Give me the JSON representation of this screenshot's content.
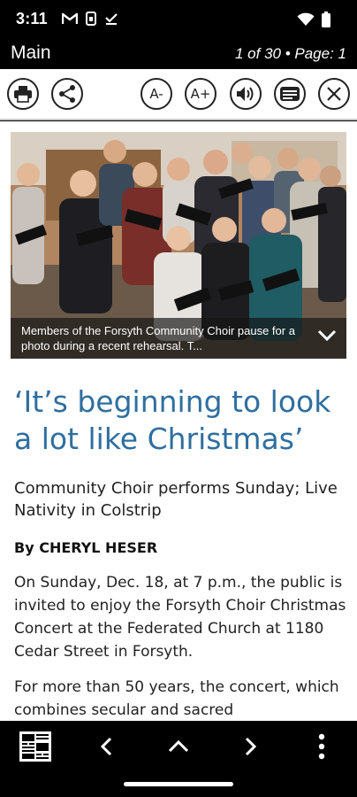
{
  "status_bar": {
    "time": "3:11",
    "left_icons": [
      "gmail-icon",
      "sim-icon",
      "check-icon"
    ],
    "right_icons": [
      "wifi-icon",
      "battery-icon"
    ]
  },
  "title_bar": {
    "title": "Main",
    "page_info": "1 of 30 • Page: 1"
  },
  "toolbar": {
    "buttons": [
      {
        "name": "print-button",
        "icon": "printer-icon"
      },
      {
        "name": "share-button",
        "icon": "share-icon"
      },
      {
        "name": "decrease-font-button",
        "label": "A-"
      },
      {
        "name": "increase-font-button",
        "label": "A+"
      },
      {
        "name": "read-aloud-button",
        "icon": "speaker-icon"
      },
      {
        "name": "text-view-button",
        "icon": "article-icon"
      },
      {
        "name": "close-button",
        "icon": "close-icon"
      }
    ]
  },
  "article": {
    "photo_caption": "Members of the Forsyth Community Choir pause for a photo during a recent rehearsal. T...",
    "headline": "‘It’s beginning to look a lot like Christmas’",
    "subhead": "Community Choir performs Sunday; Live Nativity in Colstrip",
    "byline": "By CHERYL HESER",
    "paragraph_1": "On Sunday, Dec. 18, at 7 p.m., the public is invited to enjoy the Forsyth Choir Christmas Concert at the Federated Church at 1180 Cedar Street in Forsyth.",
    "paragraph_2": "For more than 50 years, the concert, which combines secular and sacred"
  },
  "bottom_nav": {
    "buttons": [
      "page-thumbnail-icon",
      "chevron-left-icon",
      "chevron-up-icon",
      "chevron-right-icon",
      "more-vertical-icon"
    ]
  },
  "colors": {
    "headline": "#2f6f9f",
    "bars": "#000000",
    "toolbar_bg": "#ffffff"
  }
}
